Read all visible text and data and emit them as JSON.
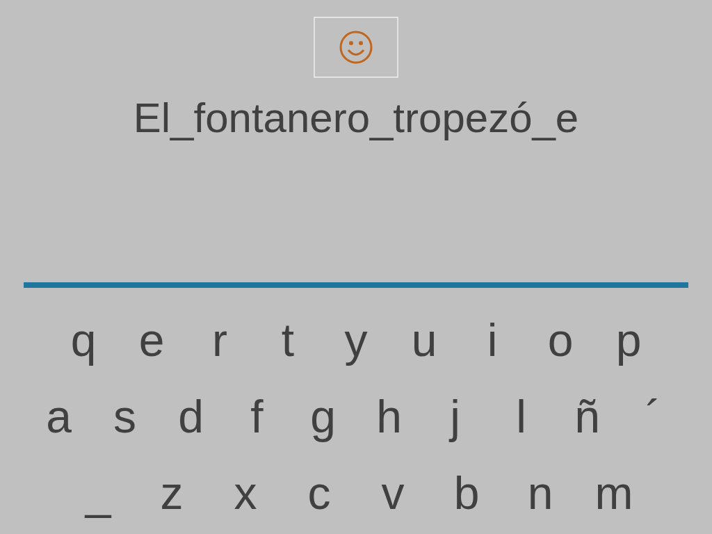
{
  "sentence": "El_fontanero_tropezó_e",
  "keyboard": {
    "rows": [
      [
        "q",
        "e",
        "r",
        "t",
        "y",
        "u",
        "i",
        "o",
        "p"
      ],
      [
        "a",
        "s",
        "d",
        "f",
        "g",
        "h",
        "j",
        "l",
        "ñ",
        "´"
      ],
      [
        "_",
        "z",
        "x",
        "c",
        "v",
        "b",
        "n",
        "m"
      ]
    ]
  }
}
